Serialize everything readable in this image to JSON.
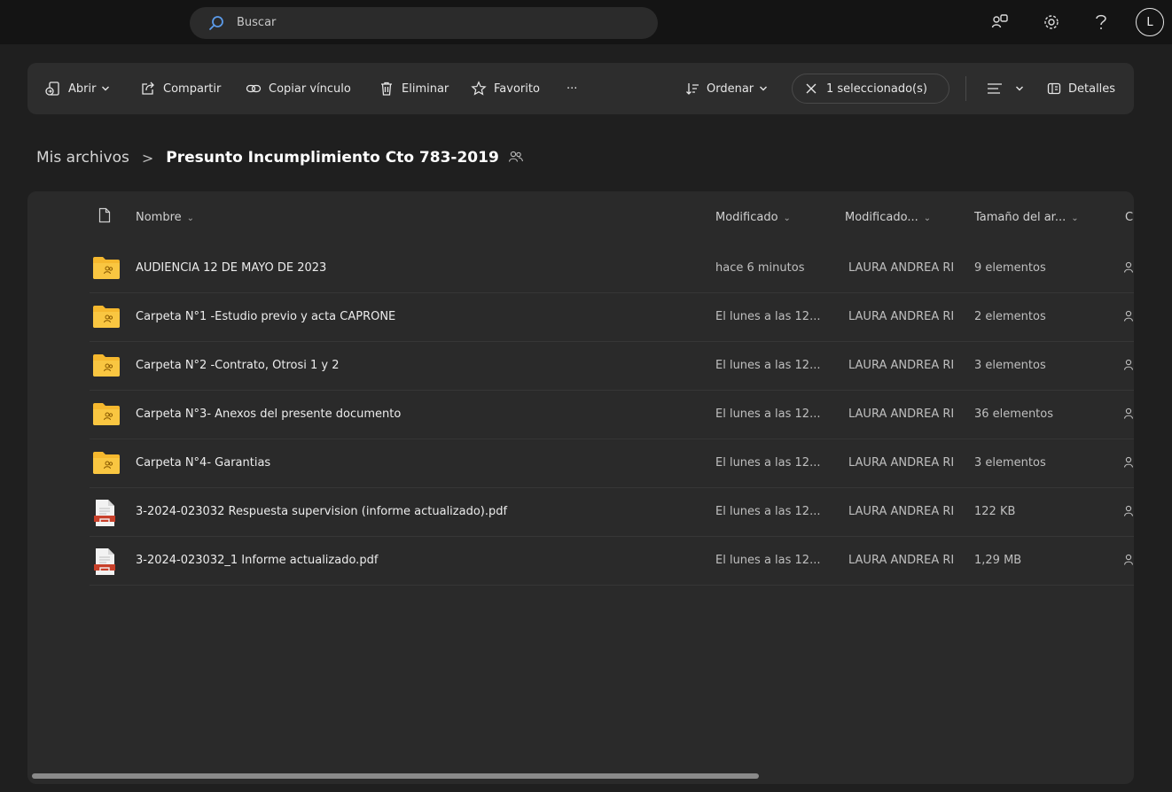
{
  "search": {
    "placeholder": "Buscar"
  },
  "topbar": {
    "avatar_initial": "L"
  },
  "toolbar": {
    "open_label": "Abrir",
    "share_label": "Compartir",
    "copy_link_label": "Copiar vínculo",
    "delete_label": "Eliminar",
    "favorite_label": "Favorito",
    "more_label": "···",
    "sort_label": "Ordenar",
    "selected_label": "1 seleccionado(s)",
    "details_label": "Detalles"
  },
  "breadcrumb": {
    "root": "Mis archivos",
    "separator": ">",
    "current": "Presunto Incumplimiento Cto 783-2019"
  },
  "columns": {
    "name": "Nombre",
    "modified": "Modificado",
    "modified_by": "Modificado...",
    "size": "Tamaño del ar...",
    "sharing": "C"
  },
  "files": [
    {
      "type": "folder",
      "name": "AUDIENCIA 12 DE MAYO DE 2023",
      "modified": "hace 6 minutos",
      "modified_by": "LAURA ANDREA RI",
      "size": "9 elementos"
    },
    {
      "type": "folder",
      "name": "Carpeta N°1 -Estudio previo y acta CAPRONE",
      "modified": "El lunes a las 12...",
      "modified_by": "LAURA ANDREA RI",
      "size": "2 elementos"
    },
    {
      "type": "folder",
      "name": "Carpeta N°2 -Contrato, Otrosi 1 y 2",
      "modified": "El lunes a las 12...",
      "modified_by": "LAURA ANDREA RI",
      "size": "3 elementos"
    },
    {
      "type": "folder",
      "name": "Carpeta N°3- Anexos del presente documento",
      "modified": "El lunes a las 12...",
      "modified_by": "LAURA ANDREA RI",
      "size": "36 elementos"
    },
    {
      "type": "folder",
      "name": "Carpeta N°4- Garantias",
      "modified": "El lunes a las 12...",
      "modified_by": "LAURA ANDREA RI",
      "size": "3 elementos"
    },
    {
      "type": "pdf",
      "name": "3-2024-023032 Respuesta supervision (informe actualizado).pdf",
      "modified": "El lunes a las 12...",
      "modified_by": "LAURA ANDREA RI",
      "size": "122 KB"
    },
    {
      "type": "pdf",
      "name": "3-2024-023032_1 Informe actualizado.pdf",
      "modified": "El lunes a las 12...",
      "modified_by": "LAURA ANDREA RI",
      "size": "1,29 MB"
    }
  ],
  "colors": {
    "folder": "#f5b82e",
    "pdf": "#c8402a",
    "background": "#1f1f1f",
    "panel": "#2a2a2a"
  }
}
